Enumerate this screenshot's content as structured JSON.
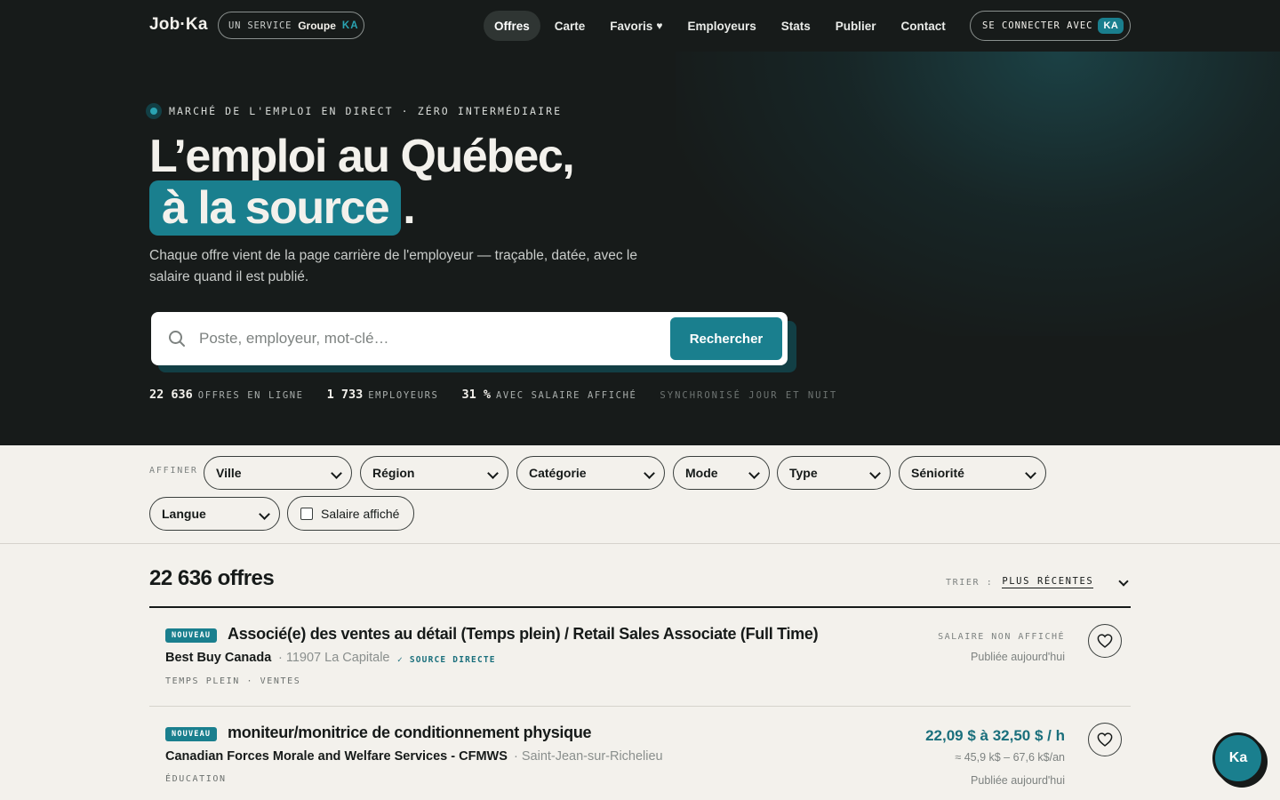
{
  "header": {
    "logo": "Job·Ka",
    "service_label": "UN SERVICE",
    "service_groupe": "Groupe",
    "service_ka": "KA",
    "nav": [
      {
        "label": "Offres"
      },
      {
        "label": "Carte"
      },
      {
        "label": "Favoris"
      },
      {
        "label": "Employeurs"
      },
      {
        "label": "Stats"
      },
      {
        "label": "Publier"
      },
      {
        "label": "Contact"
      }
    ],
    "connect_label": "SE CONNECTER AVEC",
    "connect_badge": "KA"
  },
  "hero": {
    "kicker": "MARCHÉ DE L'EMPLOI EN DIRECT · ZÉRO INTERMÉDIAIRE",
    "title_line1": "L’emploi au Québec,",
    "title_highlight": "à la source",
    "title_end": ".",
    "subtitle": "Chaque offre vient de la page carrière de l'employeur — traçable, datée, avec le salaire quand il est publié.",
    "search_placeholder": "Poste, employeur, mot-clé…",
    "search_button": "Rechercher",
    "stats": [
      {
        "num": "22 636",
        "label": "OFFRES EN LIGNE"
      },
      {
        "num": "1 733",
        "label": "EMPLOYEURS"
      },
      {
        "num": "31 %",
        "label": "AVEC SALAIRE AFFICHÉ"
      }
    ],
    "sync": "SYNCHRONISÉ JOUR ET NUIT"
  },
  "filters": {
    "label": "AFFINER",
    "selects": [
      "Ville",
      "Région",
      "Catégorie",
      "Mode",
      "Type",
      "Séniorité",
      "Langue"
    ],
    "salary_checkbox": "Salaire affiché"
  },
  "results": {
    "count": "22 636 offres",
    "sort_label": "TRIER :",
    "sort_value": "PLUS RÉCENTES",
    "jobs": [
      {
        "badge": "NOUVEAU",
        "title": "Associé(e) des ventes au détail (Temps plein) / Retail Sales Associate (Full Time)",
        "employer": "Best Buy Canada",
        "location": "· 11907 La Capitale",
        "direct": "✓ SOURCE DIRECTE",
        "tags": "TEMPS PLEIN · VENTES",
        "salary": "SALAIRE NON AFFICHÉ",
        "posted": "Publiée aujourd'hui"
      },
      {
        "badge": "NOUVEAU",
        "title": "moniteur/monitrice de conditionnement physique",
        "employer": "Canadian Forces Morale and Welfare Services - CFMWS",
        "location": "· Saint-Jean-sur-Richelieu",
        "tags": "ÉDUCATION",
        "salary": "22,09 $ à 32,50 $ / h",
        "salary_annual": "≈ 45,9 k$ – 67,6 k$/an",
        "posted": "Publiée aujourd'hui"
      }
    ]
  },
  "chat_button": "Ka",
  "colors": {
    "accent": "#1a7f8e",
    "dark": "#171b1a",
    "background": "#f3f1ec"
  }
}
